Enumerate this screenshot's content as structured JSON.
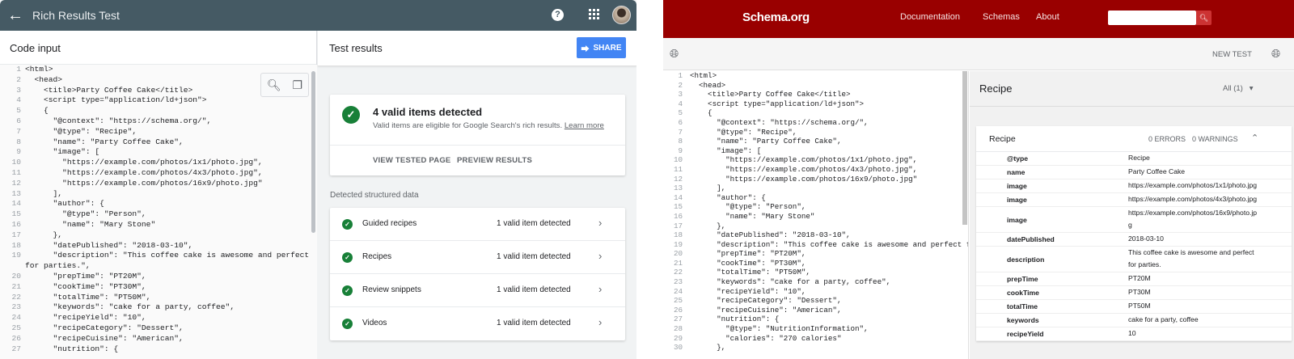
{
  "left": {
    "title": "Rich Results Test",
    "code_header": "Code input",
    "code": [
      {
        "n": "1",
        "t": "<html>"
      },
      {
        "n": "2",
        "t": "  <head>"
      },
      {
        "n": "3",
        "t": "    <title>Party Coffee Cake</title>"
      },
      {
        "n": "4",
        "t": "    <script type=\"application/ld+json\">"
      },
      {
        "n": "5",
        "t": "    {"
      },
      {
        "n": "6",
        "t": "      \"@context\": \"https://schema.org/\","
      },
      {
        "n": "7",
        "t": "      \"@type\": \"Recipe\","
      },
      {
        "n": "8",
        "t": "      \"name\": \"Party Coffee Cake\","
      },
      {
        "n": "9",
        "t": "      \"image\": ["
      },
      {
        "n": "10",
        "t": "        \"https://example.com/photos/1x1/photo.jpg\","
      },
      {
        "n": "11",
        "t": "        \"https://example.com/photos/4x3/photo.jpg\","
      },
      {
        "n": "12",
        "t": "        \"https://example.com/photos/16x9/photo.jpg\""
      },
      {
        "n": "13",
        "t": "      ],"
      },
      {
        "n": "14",
        "t": "      \"author\": {"
      },
      {
        "n": "15",
        "t": "        \"@type\": \"Person\","
      },
      {
        "n": "16",
        "t": "        \"name\": \"Mary Stone\""
      },
      {
        "n": "17",
        "t": "      },"
      },
      {
        "n": "18",
        "t": "      \"datePublished\": \"2018-03-10\","
      },
      {
        "n": "19",
        "t": "      \"description\": \"This coffee cake is awesome and perfect"
      },
      {
        "n": "",
        "t": "for parties.\","
      },
      {
        "n": "20",
        "t": "      \"prepTime\": \"PT20M\","
      },
      {
        "n": "21",
        "t": "      \"cookTime\": \"PT30M\","
      },
      {
        "n": "22",
        "t": "      \"totalTime\": \"PT50M\","
      },
      {
        "n": "23",
        "t": "      \"keywords\": \"cake for a party, coffee\","
      },
      {
        "n": "24",
        "t": "      \"recipeYield\": \"10\","
      },
      {
        "n": "25",
        "t": "      \"recipeCategory\": \"Dessert\","
      },
      {
        "n": "26",
        "t": "      \"recipeCuisine\": \"American\","
      },
      {
        "n": "27",
        "t": "      \"nutrition\": {"
      }
    ],
    "results_header": "Test results",
    "share_label": "SHARE",
    "summary_title": "4 valid items detected",
    "summary_sub": "Valid items are eligible for Google Search's rich results.",
    "learn_more": "Learn more",
    "view_tested": "VIEW TESTED PAGE",
    "preview": "PREVIEW RESULTS",
    "detected_label": "Detected structured data",
    "items": [
      {
        "name": "Guided recipes",
        "status": "1 valid item detected"
      },
      {
        "name": "Recipes",
        "status": "1 valid item detected"
      },
      {
        "name": "Review snippets",
        "status": "1 valid item detected"
      },
      {
        "name": "Videos",
        "status": "1 valid item detected"
      }
    ]
  },
  "right": {
    "logo": "Schema.org",
    "nav": [
      "Documentation",
      "Schemas",
      "About"
    ],
    "new_test": "NEW TEST",
    "code": [
      {
        "n": "1",
        "t": "<html>"
      },
      {
        "n": "2",
        "t": "  <head>"
      },
      {
        "n": "3",
        "t": "    <title>Party Coffee Cake</title>"
      },
      {
        "n": "4",
        "t": "    <script type=\"application/ld+json\">"
      },
      {
        "n": "5",
        "t": "    {"
      },
      {
        "n": "6",
        "t": "      \"@context\": \"https://schema.org/\","
      },
      {
        "n": "7",
        "t": "      \"@type\": \"Recipe\","
      },
      {
        "n": "8",
        "t": "      \"name\": \"Party Coffee Cake\","
      },
      {
        "n": "9",
        "t": "      \"image\": ["
      },
      {
        "n": "10",
        "t": "        \"https://example.com/photos/1x1/photo.jpg\","
      },
      {
        "n": "11",
        "t": "        \"https://example.com/photos/4x3/photo.jpg\","
      },
      {
        "n": "12",
        "t": "        \"https://example.com/photos/16x9/photo.jpg\""
      },
      {
        "n": "13",
        "t": "      ],"
      },
      {
        "n": "14",
        "t": "      \"author\": {"
      },
      {
        "n": "15",
        "t": "        \"@type\": \"Person\","
      },
      {
        "n": "16",
        "t": "        \"name\": \"Mary Stone\""
      },
      {
        "n": "17",
        "t": "      },"
      },
      {
        "n": "18",
        "t": "      \"datePublished\": \"2018-03-10\","
      },
      {
        "n": "19",
        "t": "      \"description\": \"This coffee cake is awesome and perfect for partie"
      },
      {
        "n": "20",
        "t": "      \"prepTime\": \"PT20M\","
      },
      {
        "n": "21",
        "t": "      \"cookTime\": \"PT30M\","
      },
      {
        "n": "22",
        "t": "      \"totalTime\": \"PT50M\","
      },
      {
        "n": "23",
        "t": "      \"keywords\": \"cake for a party, coffee\","
      },
      {
        "n": "24",
        "t": "      \"recipeYield\": \"10\","
      },
      {
        "n": "25",
        "t": "      \"recipeCategory\": \"Dessert\","
      },
      {
        "n": "26",
        "t": "      \"recipeCuisine\": \"American\","
      },
      {
        "n": "27",
        "t": "      \"nutrition\": {"
      },
      {
        "n": "28",
        "t": "        \"@type\": \"NutritionInformation\","
      },
      {
        "n": "29",
        "t": "        \"calories\": \"270 calories\""
      },
      {
        "n": "30",
        "t": "      },"
      }
    ],
    "result_title": "Recipe",
    "all_select": "All (1)",
    "table_title": "Recipe",
    "errors": "0 ERRORS",
    "warnings": "0 WARNINGS",
    "props": [
      {
        "k": "@type",
        "v": "Recipe"
      },
      {
        "k": "name",
        "v": "Party Coffee Cake"
      },
      {
        "k": "image",
        "v": "https://example.com/photos/1x1/photo.jpg"
      },
      {
        "k": "image",
        "v": "https://example.com/photos/4x3/photo.jpg"
      },
      {
        "k": "image",
        "v": "https://example.com/photos/16x9/photo.jpg"
      },
      {
        "k": "datePublished",
        "v": "2018-03-10"
      },
      {
        "k": "description",
        "v": "This coffee cake is awesome and perfect for parties."
      },
      {
        "k": "prepTime",
        "v": "PT20M"
      },
      {
        "k": "cookTime",
        "v": "PT30M"
      },
      {
        "k": "totalTime",
        "v": "PT50M"
      },
      {
        "k": "keywords",
        "v": "cake for a party, coffee"
      },
      {
        "k": "recipeYield",
        "v": "10"
      }
    ]
  },
  "icons": {
    "back": "arrow-left-icon",
    "help": "help-icon",
    "apps": "apps-grid-icon",
    "search": "search-icon",
    "copy": "copy-icon",
    "share": "share-icon",
    "check": "check-circle-icon",
    "chevron": "chevron-right-icon",
    "globe": "globe-icon",
    "collapse": "chevron-up-icon",
    "dropdown": "caret-down-icon"
  },
  "colors": {
    "google_bar": "#455a64",
    "share_blue": "#4285f4",
    "valid_green": "#188038",
    "schema_red": "#990000"
  }
}
